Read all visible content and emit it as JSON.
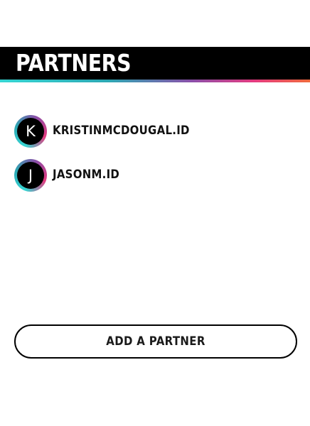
{
  "header": {
    "title": "PARTNERS"
  },
  "partners": [
    {
      "initial": "K",
      "name": "KRISTINMCDOUGAL.ID"
    },
    {
      "initial": "J",
      "name": "JASONM.ID"
    }
  ],
  "actions": {
    "add_partner_label": "ADD A PARTNER"
  },
  "colors": {
    "header_background": "#000000",
    "header_text": "#ffffff",
    "stripe_gradient": [
      "#36d6d3",
      "#2ca7b3",
      "#8a4ea8",
      "#e43a7f",
      "#ef6a3c"
    ],
    "avatar_background": "#000000"
  }
}
